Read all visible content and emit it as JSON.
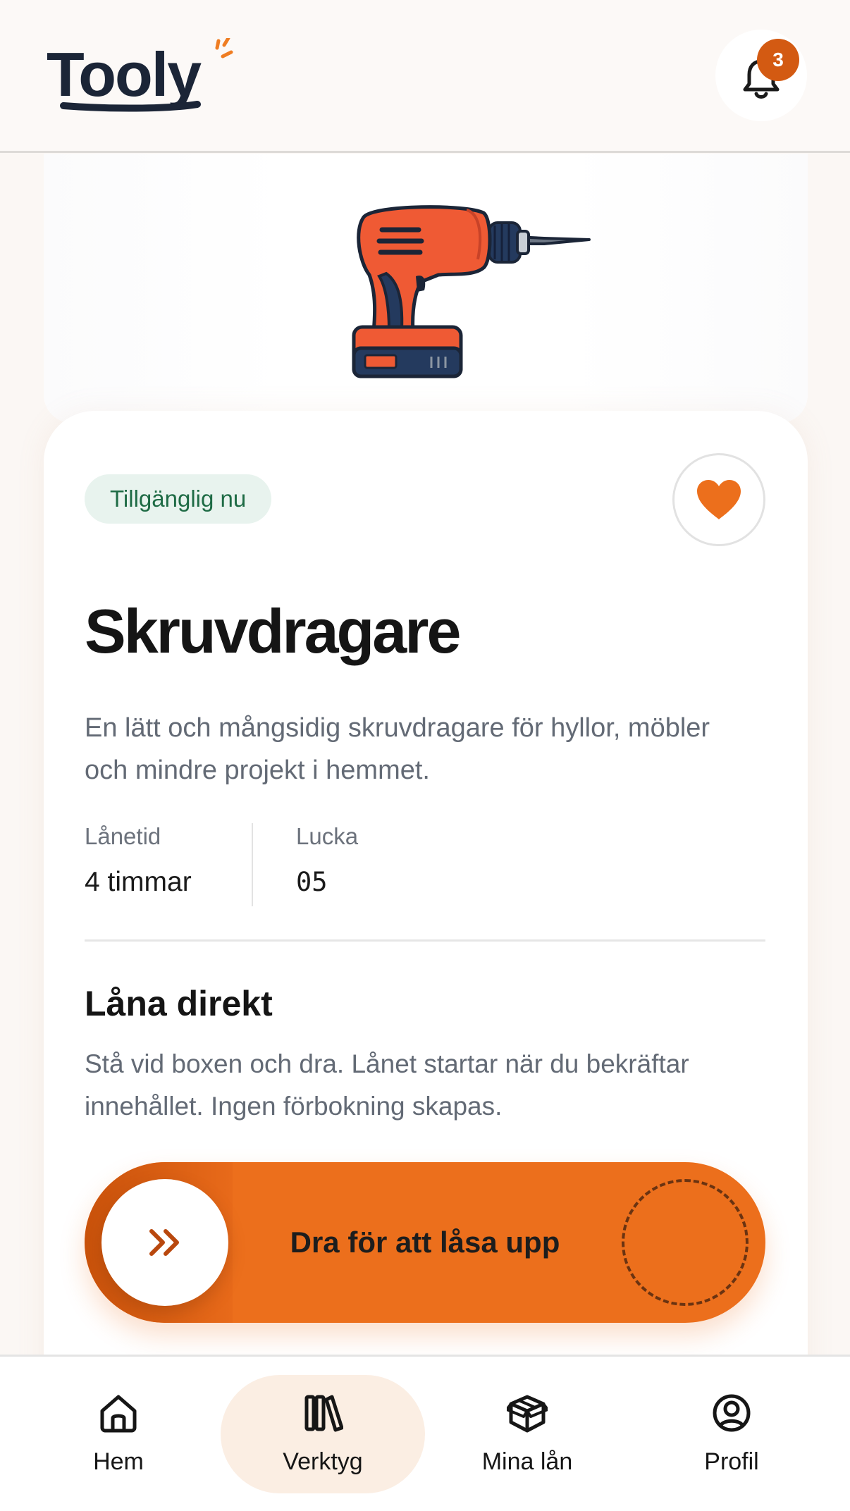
{
  "header": {
    "logo_text": "Tooly",
    "notifications_count": "3"
  },
  "product": {
    "status_badge": "Tillgänglig nu",
    "name": "Skruvdragare",
    "description": "En lätt och mångsidig skruvdragare för hyllor, möbler och mindre projekt i hemmet.",
    "favorite": true,
    "meta": [
      {
        "label": "Lånetid",
        "value": "4 timmar"
      },
      {
        "label": "Lucka",
        "value": "05"
      }
    ]
  },
  "borrow": {
    "title": "Låna direkt",
    "text": "Stå vid boxen och dra. Lånet startar när du bekräftar innehållet. Ingen förbokning skapas.",
    "slider_label": "Dra för att låsa upp"
  },
  "nav": {
    "items": [
      {
        "label": "Hem",
        "icon": "home-icon"
      },
      {
        "label": "Verktyg",
        "icon": "tools-icon",
        "active": true
      },
      {
        "label": "Mina lån",
        "icon": "box-icon"
      },
      {
        "label": "Profil",
        "icon": "profile-icon"
      }
    ]
  },
  "colors": {
    "accent": "#ec6f1c",
    "accent_dark": "#d35a12",
    "available_bg": "#e8f3ee",
    "available_text": "#1e6b45",
    "active_nav_bg": "#fbeee3"
  }
}
